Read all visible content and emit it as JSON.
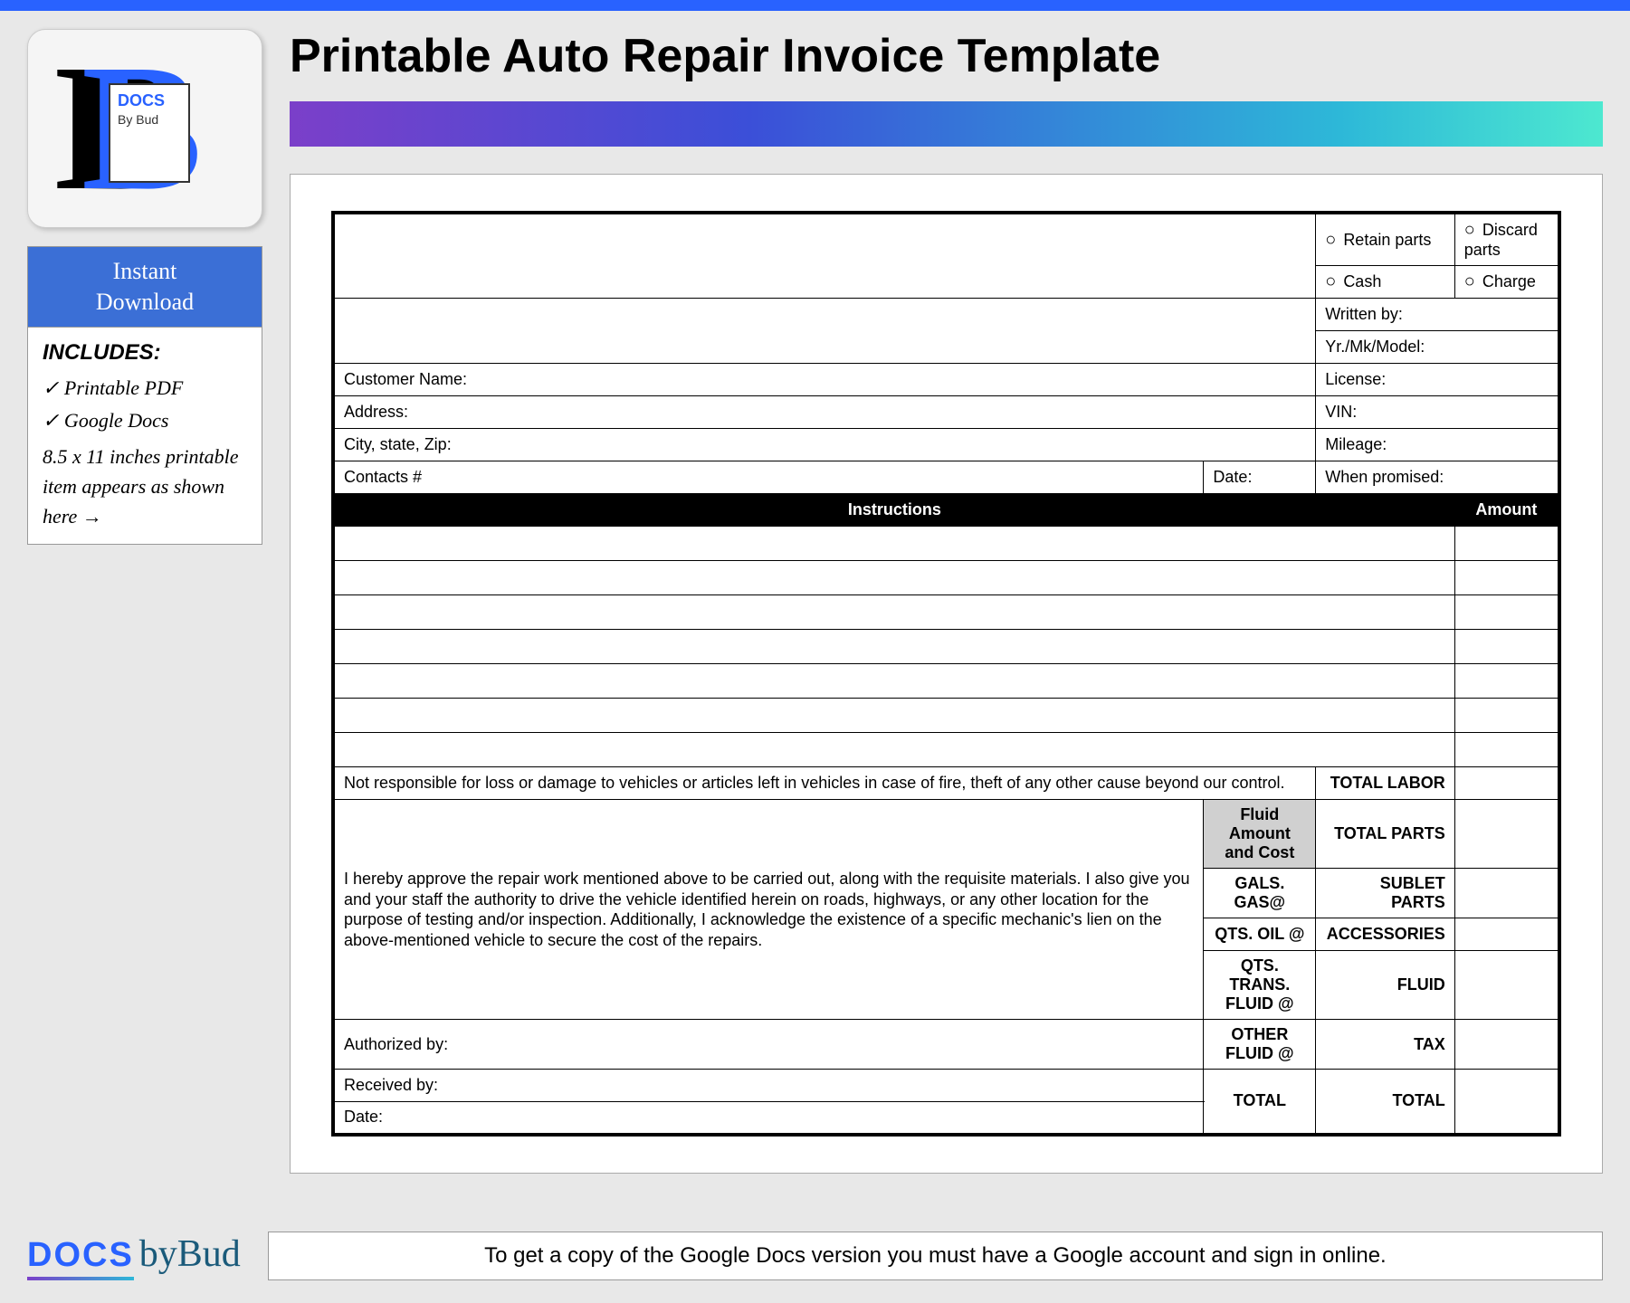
{
  "page_title": "Printable Auto Repair Invoice Template",
  "sidebar": {
    "instant_download": "Instant\nDownload",
    "includes_label": "INCLUDES:",
    "item1": "✓ Printable PDF",
    "item2": "✓ Google Docs",
    "description": "8.5 x 11 inches printable item appears as shown here →"
  },
  "logo": {
    "docs": "DOCS",
    "bybud": "By Bud"
  },
  "invoice": {
    "retain_parts": "Retain parts",
    "discard_parts": "Discard parts",
    "cash": "Cash",
    "charge": "Charge",
    "written_by": "Written by:",
    "yr_mk_model": "Yr./Mk/Model:",
    "customer_name": "Customer Name:",
    "license": "License:",
    "address": "Address:",
    "vin": "VIN:",
    "city_state_zip": "City, state, Zip:",
    "mileage": "Mileage:",
    "contacts": "Contacts #",
    "date": "Date:",
    "when_promised": "When promised:",
    "instructions_header": "Instructions",
    "amount_header": "Amount",
    "disclaimer": "Not responsible for loss or damage to vehicles or articles left in vehicles in case of fire, theft of any other cause beyond our control.",
    "authorization": "I hereby approve the repair work mentioned above to be carried out, along with the requisite materials. I also give you and your staff the authority to drive the vehicle identified herein on roads, highways, or any other location for the purpose of testing and/or inspection. Additionally, I acknowledge the existence of a specific mechanic's lien on the above-mentioned vehicle to secure the cost of the repairs.",
    "authorized_by": "Authorized by:",
    "received_by": "Received by:",
    "date2": "Date:",
    "fluid_header": "Fluid Amount and Cost",
    "gals_gas": "GALS. GAS@",
    "qts_oil": "QTS. OIL @",
    "qts_trans": "QTS. TRANS. FLUID @",
    "other_fluid": "OTHER FLUID @",
    "total_fluid": "TOTAL",
    "total_labor": "TOTAL LABOR",
    "total_parts": "TOTAL PARTS",
    "sublet_parts": "SUBLET PARTS",
    "accessories": "ACCESSORIES",
    "fluid": "FLUID",
    "tax": "TAX",
    "total": "TOTAL"
  },
  "footer": {
    "docs": "DOCS",
    "bybud": "byBud",
    "note": "To get a copy of the Google Docs version you must have a Google account and sign in online."
  }
}
